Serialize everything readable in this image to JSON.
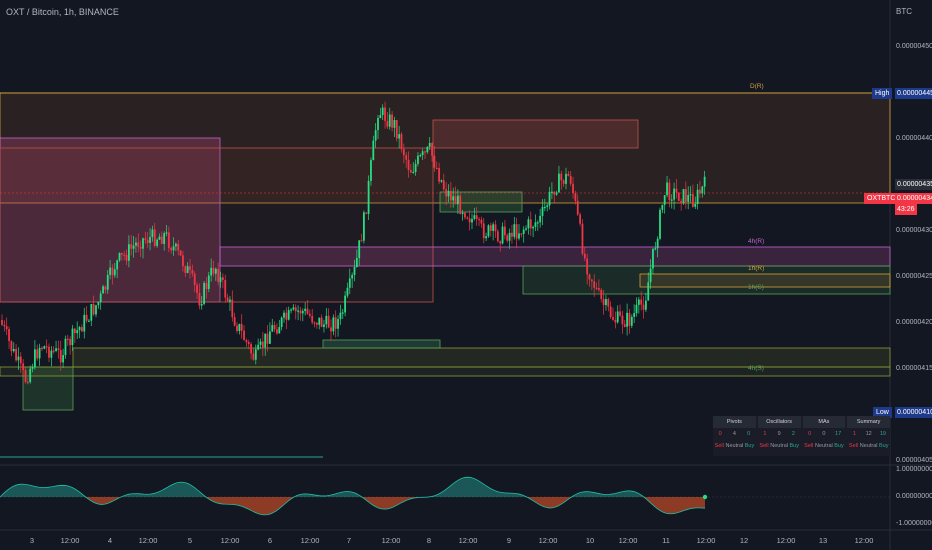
{
  "header": {
    "title": "OXT / Bitcoin, 1h, BINANCE",
    "currency": "BTC"
  },
  "price_axis": {
    "ticks": [
      "0.00000450",
      "0.00000445",
      "0.00000440",
      "0.00000435",
      "0.00000430",
      "0.00000425",
      "0.00000420",
      "0.00000415",
      "0.00000410",
      "0.00000405"
    ],
    "tick_values": [
      450,
      445,
      440,
      435,
      430,
      425,
      420,
      415,
      410,
      405
    ],
    "high": {
      "label": "High",
      "value": "0.00000445"
    },
    "low": {
      "label": "Low",
      "value": "0.00000410"
    },
    "symbol_badge": "OXTBTC",
    "last_price": "0.00000434",
    "countdown": "43:26",
    "current_value": "0.00000435"
  },
  "oscillator_axis": {
    "ticks": [
      "1.00000000",
      "0.00000000",
      "-1.00000000"
    ]
  },
  "time_axis": {
    "ticks": [
      "3",
      "12:00",
      "4",
      "12:00",
      "5",
      "12:00",
      "6",
      "12:00",
      "7",
      "12:00",
      "8",
      "12:00",
      "9",
      "12:00",
      "10",
      "12:00",
      "11",
      "12:00",
      "12",
      "12:00",
      "13",
      "12:00"
    ]
  },
  "zone_labels": [
    {
      "text": "D(R)",
      "color": "#d4a03a"
    },
    {
      "text": "4h(R)",
      "color": "#c663d1"
    },
    {
      "text": "1h(R)",
      "color": "#d4a03a"
    },
    {
      "text": "1h(S)",
      "color": "#5aa05a"
    },
    {
      "text": "4h(S)",
      "color": "#5aa05a"
    }
  ],
  "summary_table": {
    "columns": [
      {
        "title": "Pivots",
        "counts": [
          "0",
          "4",
          "0"
        ],
        "labels": [
          "Sell",
          "Neutral",
          "Buy"
        ]
      },
      {
        "title": "Oscillators",
        "counts": [
          "1",
          "9",
          "2"
        ],
        "labels": [
          "Sell",
          "Neutral",
          "Buy"
        ]
      },
      {
        "title": "MAs",
        "counts": [
          "0",
          "0",
          "17"
        ],
        "labels": [
          "Sell",
          "Neutral",
          "Buy"
        ]
      },
      {
        "title": "Summary",
        "counts": [
          "1",
          "12",
          "19"
        ],
        "labels": [
          "Sell",
          "Neutral",
          "Buy"
        ]
      }
    ]
  },
  "colors": {
    "background": "#131722",
    "up_candle": "#26de81",
    "down_candle": "#f23645",
    "high_line": "#d4a03a",
    "resistance_4h": "#c663d1",
    "support": "#5aa05a",
    "price_badge_red": "#f23645",
    "high_low_badge": "#1e3a8a"
  }
}
